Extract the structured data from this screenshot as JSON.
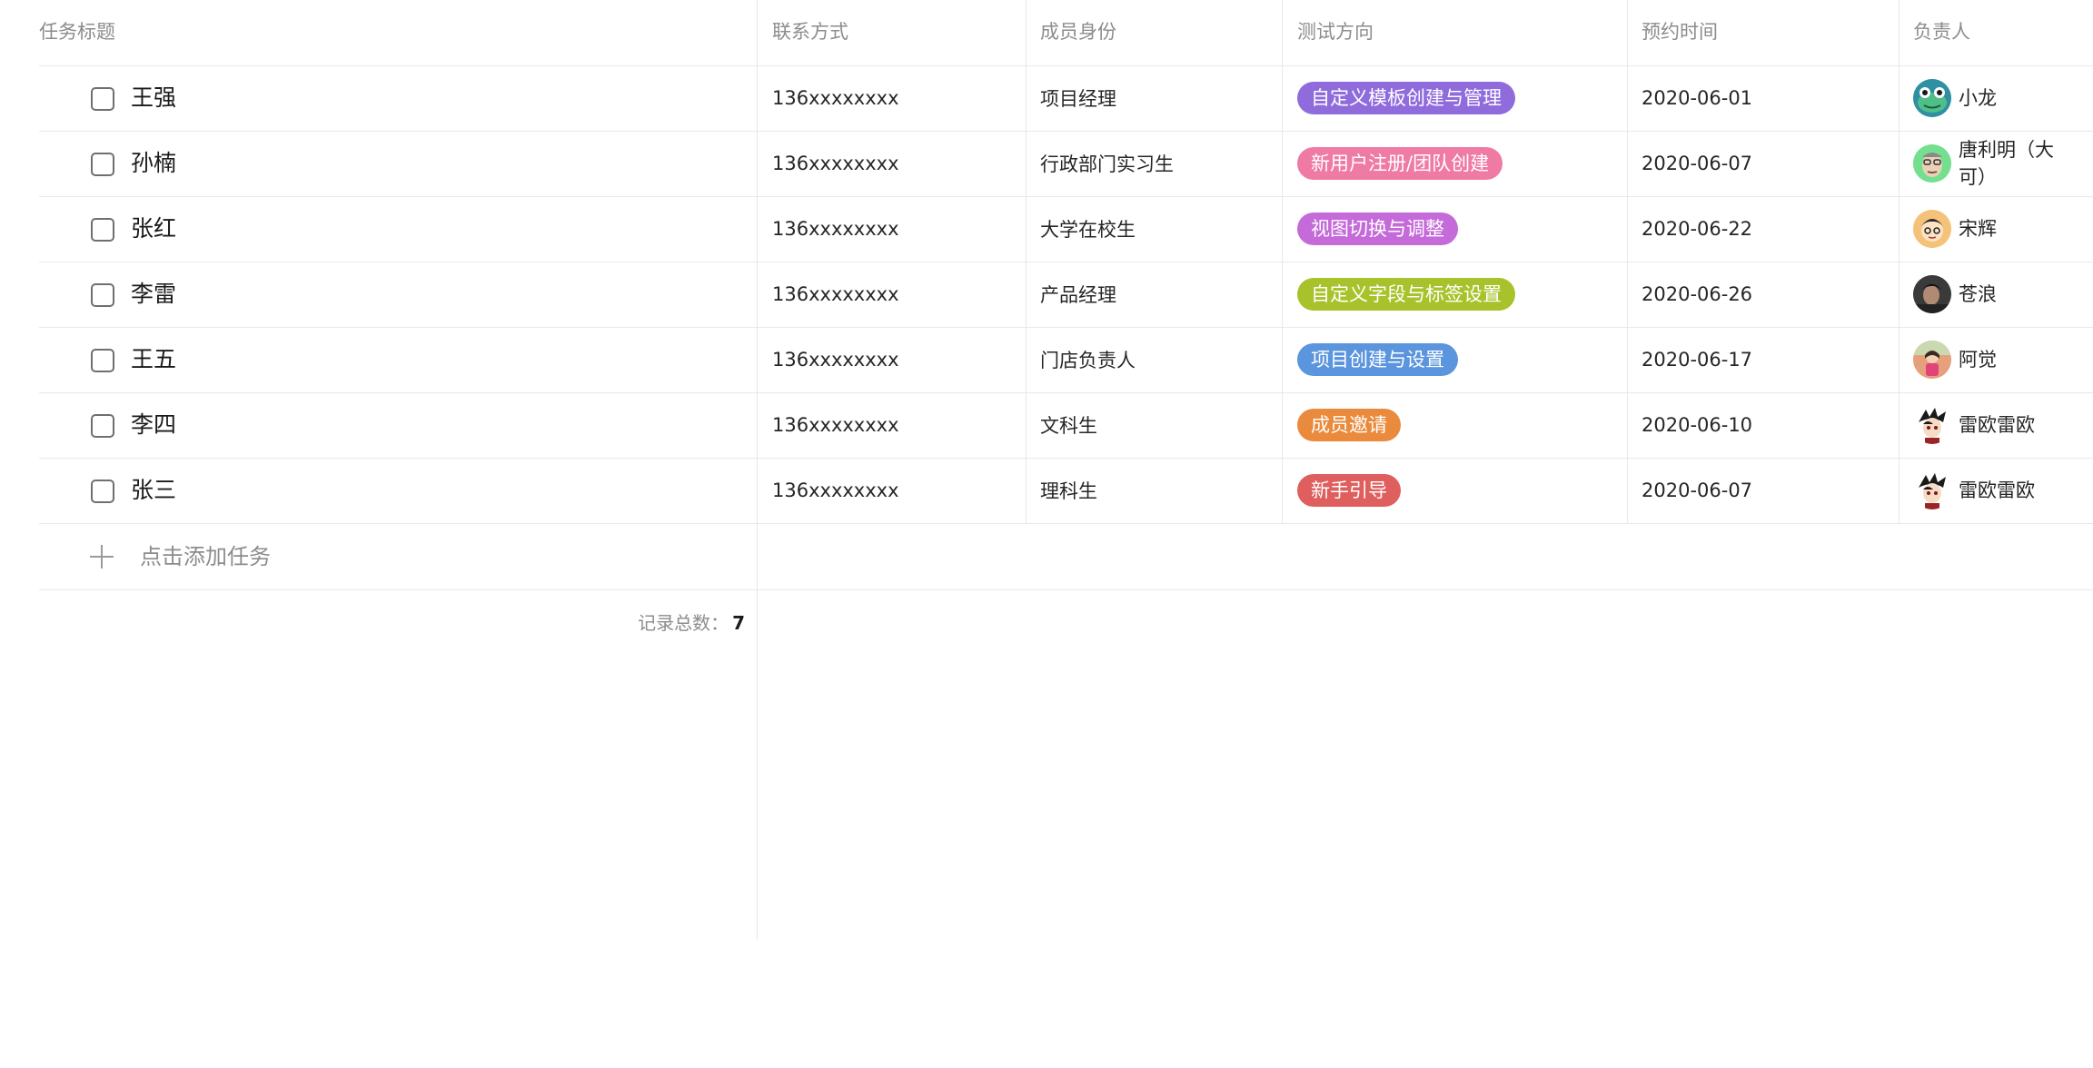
{
  "columns": {
    "title": "任务标题",
    "contact": "联系方式",
    "identity": "成员身份",
    "direction": "测试方向",
    "date": "预约时间",
    "owner": "负责人"
  },
  "rows": [
    {
      "title": "王强",
      "contact": "136xxxxxxxx",
      "identity": "项目经理",
      "direction": "自定义模板创建与管理",
      "tag_color": "#8f6bdc",
      "date": "2020-06-01",
      "owner": "小龙",
      "avatar_icon": "frog-avatar-icon",
      "avatar_bg": "#2f8fa3"
    },
    {
      "title": "孙楠",
      "contact": "136xxxxxxxx",
      "identity": "行政部门实习生",
      "direction": "新用户注册/团队创建",
      "tag_color": "#ef7aa3",
      "date": "2020-06-07",
      "owner": "唐利明（大可）",
      "avatar_icon": "face-avatar-icon",
      "avatar_bg": "#74e08f"
    },
    {
      "title": "张红",
      "contact": "136xxxxxxxx",
      "identity": "大学在校生",
      "direction": "视图切换与调整",
      "tag_color": "#c46ad9",
      "date": "2020-06-22",
      "owner": "宋辉",
      "avatar_icon": "cartoon-avatar-icon",
      "avatar_bg": "#f5c27a"
    },
    {
      "title": "李雷",
      "contact": "136xxxxxxxx",
      "identity": "产品经理",
      "direction": "自定义字段与标签设置",
      "tag_color": "#a8c22b",
      "date": "2020-06-26",
      "owner": "苍浪",
      "avatar_icon": "photo-avatar-icon",
      "avatar_bg": "#3a3a3a"
    },
    {
      "title": "王五",
      "contact": "136xxxxxxxx",
      "identity": "门店负责人",
      "direction": "项目创建与设置",
      "tag_color": "#5a95dd",
      "date": "2020-06-17",
      "owner": "阿觉",
      "avatar_icon": "girl-avatar-icon",
      "avatar_bg": "#e6a07c"
    },
    {
      "title": "李四",
      "contact": "136xxxxxxxx",
      "identity": "文科生",
      "direction": "成员邀请",
      "tag_color": "#ea8a3c",
      "date": "2020-06-10",
      "owner": "雷欧雷欧",
      "avatar_icon": "anime-avatar-icon",
      "avatar_bg": "#ffffff"
    },
    {
      "title": "张三",
      "contact": "136xxxxxxxx",
      "identity": "理科生",
      "direction": "新手引导",
      "tag_color": "#df5f5f",
      "date": "2020-06-07",
      "owner": "雷欧雷欧",
      "avatar_icon": "anime-avatar-icon",
      "avatar_bg": "#ffffff"
    }
  ],
  "add_task": {
    "label": "点击添加任务"
  },
  "footer": {
    "label": "记录总数：",
    "count": "7"
  }
}
